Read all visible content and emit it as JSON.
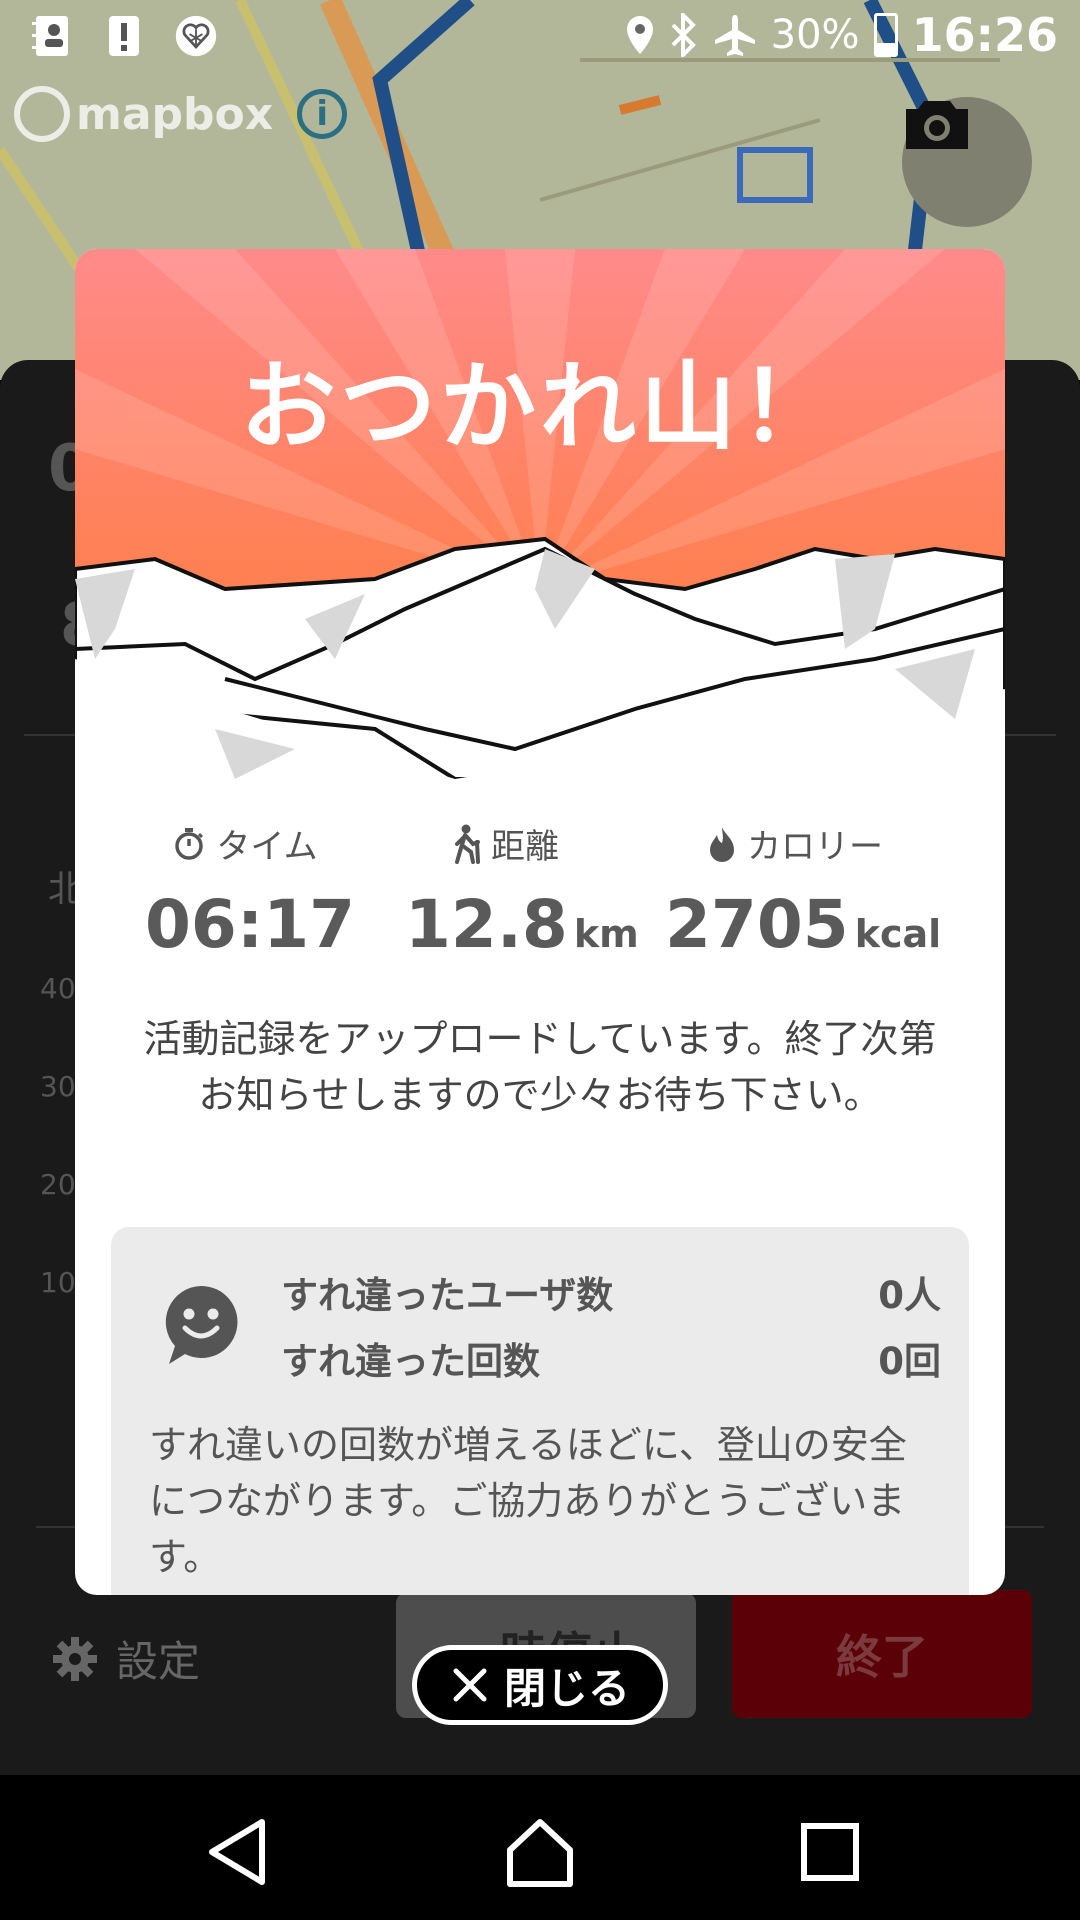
{
  "status_bar": {
    "battery_percent": "30%",
    "time": "16:26",
    "icons": [
      "contacts-icon",
      "alert-icon",
      "app-icon",
      "location-icon",
      "bluetooth-icon",
      "airplane-icon",
      "battery-icon"
    ]
  },
  "map": {
    "attribution": "mapbox",
    "info_icon": "i"
  },
  "background": {
    "stat_left": "0",
    "stat_left2": "8",
    "label_left": "北",
    "axis": [
      "40",
      "30",
      "20",
      "10"
    ],
    "settings_label": "設定",
    "pause_label": "一時停止",
    "end_label": "終了"
  },
  "dialog": {
    "title": "おつかれ山！",
    "stats": [
      {
        "label": "タイム",
        "value": "06:17",
        "unit": "",
        "icon": "stopwatch-icon"
      },
      {
        "label": "距離",
        "value": "12.8",
        "unit": "km",
        "icon": "hiker-icon"
      },
      {
        "label": "カロリー",
        "value": "2705",
        "unit": "kcal",
        "icon": "flame-icon"
      }
    ],
    "message": "活動記録をアップロードしています。終了次第お知らせしますので少々お待ち下さい。",
    "encounter": {
      "users_label": "すれ違ったユーザ数",
      "users_value": "0人",
      "count_label": "すれ違った回数",
      "count_value": "0回",
      "note": "すれ違いの回数が増えるほどに、登山の安全につながります。ご協力ありがとうございます。"
    }
  },
  "close_button": "閉じる",
  "colors": {
    "hero_top": "#ff8a8a",
    "hero_bottom": "#ff7a30",
    "end_button": "#5c0008"
  }
}
